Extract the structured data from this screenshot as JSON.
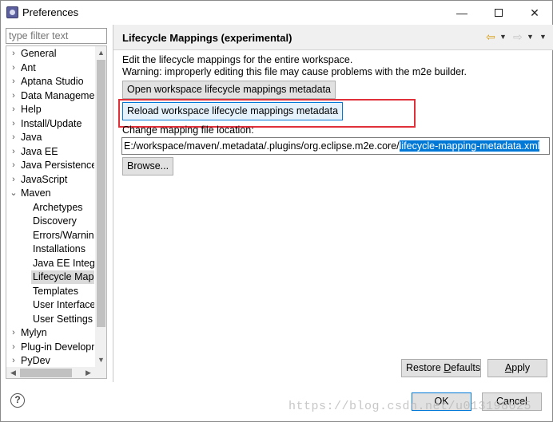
{
  "window": {
    "title": "Preferences",
    "minimize_glyph": "—",
    "close_glyph": "✕"
  },
  "sidebar": {
    "filter_placeholder": "type filter text",
    "items": [
      {
        "label": "General",
        "arrow": "›",
        "level": 0
      },
      {
        "label": "Ant",
        "arrow": "›",
        "level": 0
      },
      {
        "label": "Aptana Studio",
        "arrow": "›",
        "level": 0
      },
      {
        "label": "Data Managemer",
        "arrow": "›",
        "level": 0
      },
      {
        "label": "Help",
        "arrow": "›",
        "level": 0
      },
      {
        "label": "Install/Update",
        "arrow": "›",
        "level": 0
      },
      {
        "label": "Java",
        "arrow": "›",
        "level": 0
      },
      {
        "label": "Java EE",
        "arrow": "›",
        "level": 0
      },
      {
        "label": "Java Persistence",
        "arrow": "›",
        "level": 0
      },
      {
        "label": "JavaScript",
        "arrow": "›",
        "level": 0
      },
      {
        "label": "Maven",
        "arrow": "⌄",
        "level": 0
      },
      {
        "label": "Archetypes",
        "arrow": "",
        "level": 1
      },
      {
        "label": "Discovery",
        "arrow": "",
        "level": 1
      },
      {
        "label": "Errors/Warnin",
        "arrow": "",
        "level": 1
      },
      {
        "label": "Installations",
        "arrow": "",
        "level": 1
      },
      {
        "label": "Java EE Integra",
        "arrow": "",
        "level": 1
      },
      {
        "label": "Lifecycle Mapp",
        "arrow": "",
        "level": 1,
        "selected": true
      },
      {
        "label": "Templates",
        "arrow": "",
        "level": 1
      },
      {
        "label": "User Interface",
        "arrow": "",
        "level": 1
      },
      {
        "label": "User Settings",
        "arrow": "",
        "level": 1
      },
      {
        "label": "Mylyn",
        "arrow": "›",
        "level": 0
      },
      {
        "label": "Plug-in Developr",
        "arrow": "›",
        "level": 0
      },
      {
        "label": "PyDev",
        "arrow": "›",
        "level": 0
      }
    ]
  },
  "page": {
    "title": "Lifecycle Mappings (experimental)",
    "desc_line1": "Edit the lifecycle mappings for the entire workspace.",
    "desc_line2": "Warning: improperly editing this file may cause problems with the m2e builder.",
    "open_button": "Open workspace lifecycle mappings metadata",
    "reload_button": "Reload workspace lifecycle mappings metadata",
    "change_label": "Change mapping file location:",
    "path_prefix": "E:/workspace/maven/.metadata/.plugins/org.eclipse.m2e.core/",
    "path_selected": "lifecycle-mapping-metadata.xml",
    "browse_button": "Browse...",
    "restore_prefix": "Restore ",
    "restore_accel": "D",
    "restore_suffix": "efaults",
    "apply_accel": "A",
    "apply_suffix": "pply"
  },
  "footer": {
    "help_glyph": "?",
    "ok_button": "OK",
    "cancel_button": "Cancel",
    "watermark": "https://blog.csdn.net/u013198025"
  },
  "colors": {
    "accent": "#0078d7",
    "highlight": "#e0303a"
  }
}
